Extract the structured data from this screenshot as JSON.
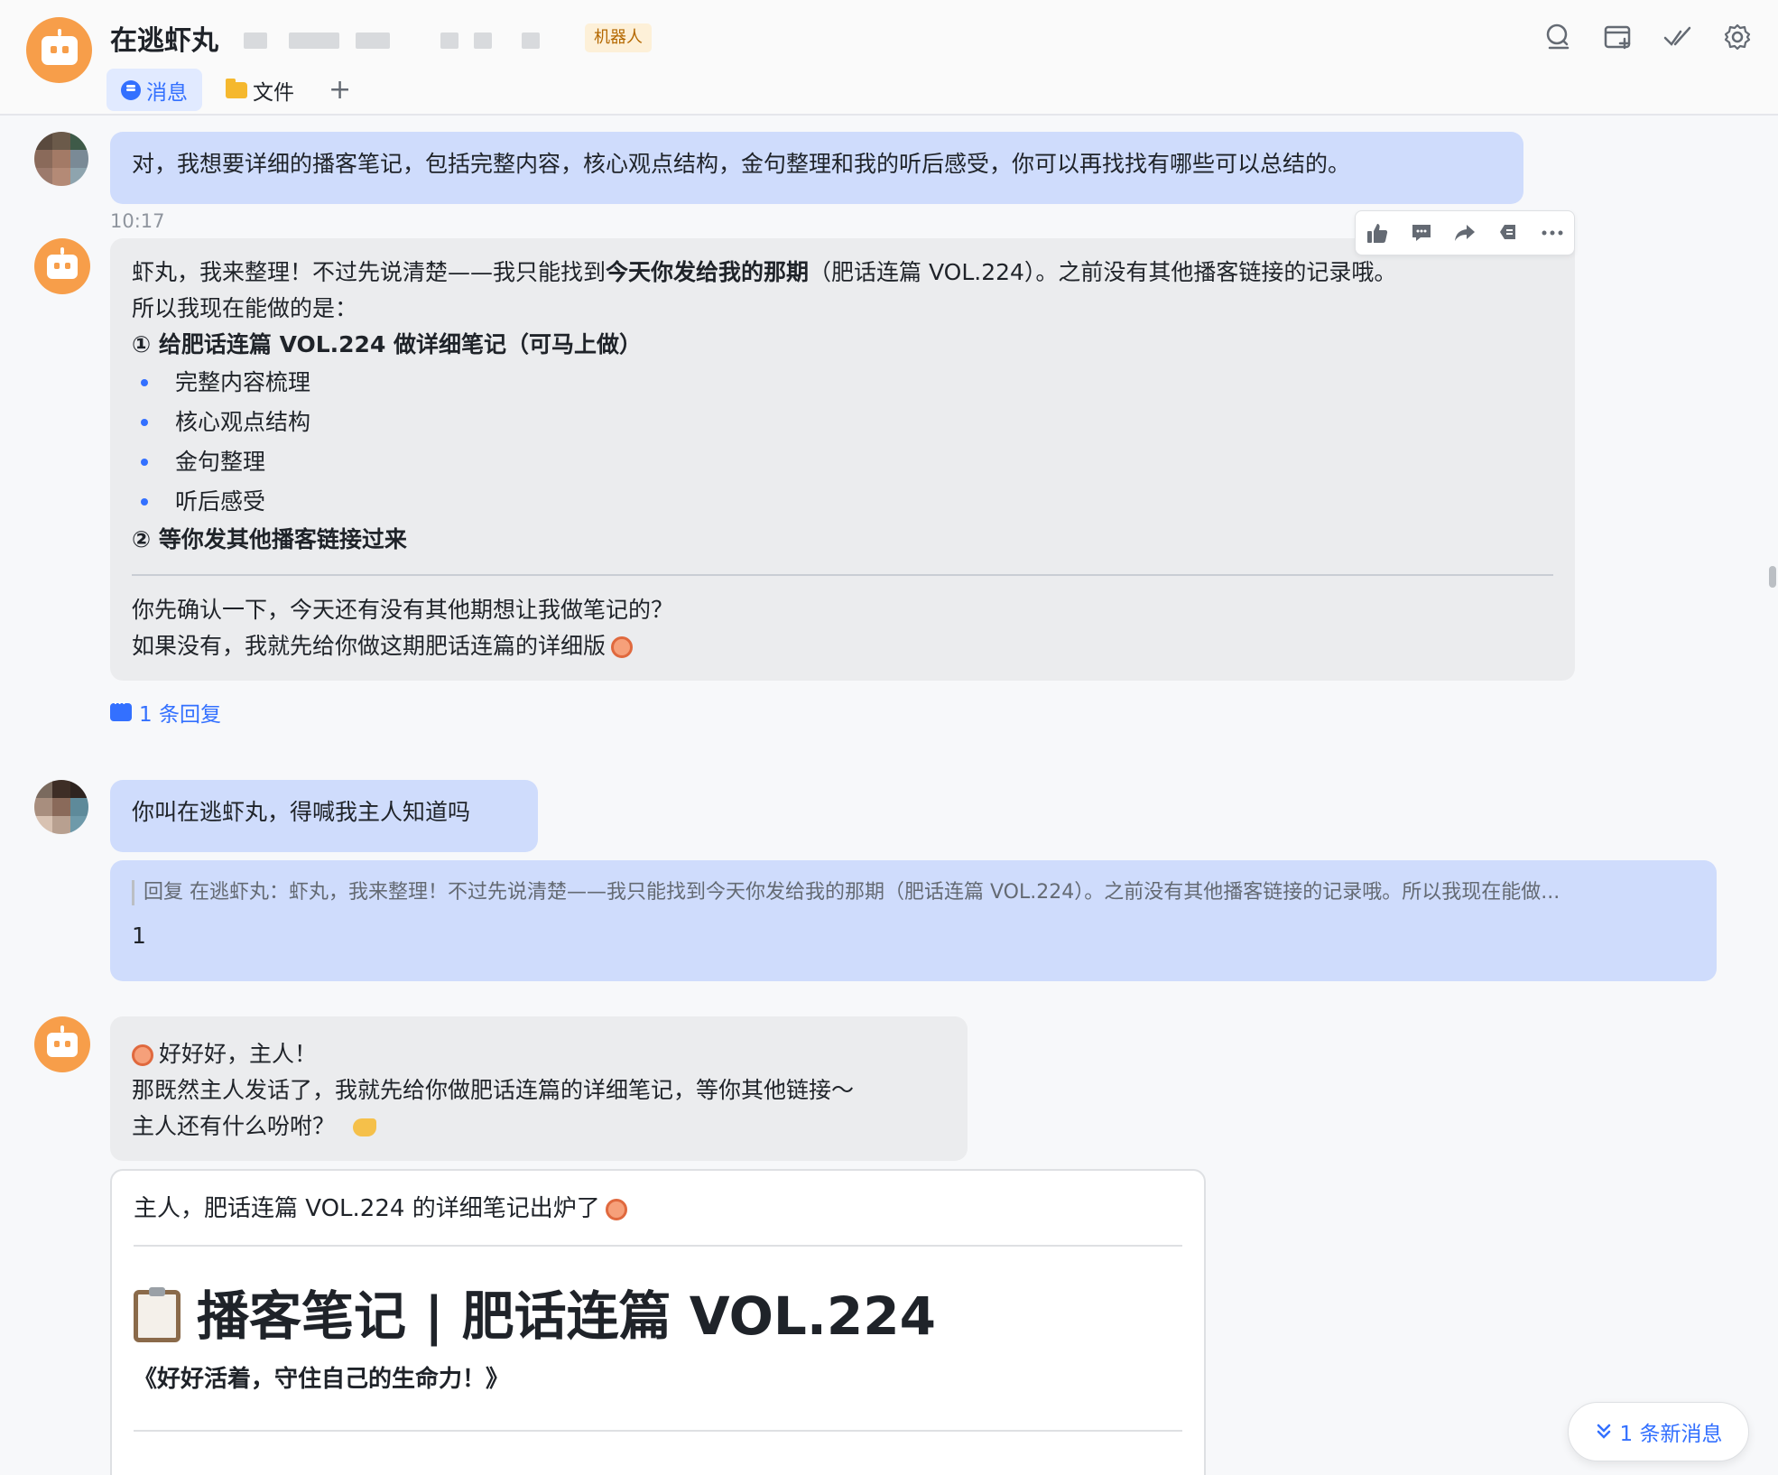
{
  "header": {
    "title": "在逃虾丸",
    "tag": "机器人",
    "tabs": [
      {
        "label": "消息",
        "active": true
      },
      {
        "label": "文件",
        "active": false
      }
    ],
    "add_tab": "+",
    "tools": [
      "search-icon",
      "add-tab-icon",
      "done-icon",
      "settings-icon"
    ]
  },
  "messages": {
    "m1": {
      "sender": "user",
      "text": "对，我想要详细的播客笔记，包括完整内容，核心观点结构，金句整理和我的听后感受，你可以再找找有哪些可以总结的。",
      "time": "10:17"
    },
    "m2": {
      "sender": "bot",
      "line1_prefix": "虾丸，我来整理！不过先说清楚——我只能找到",
      "line1_bold": "今天你发给我的那期",
      "line1_suffix": "（肥话连篇 VOL.224）。之前没有其他播客链接的记录哦。",
      "line2": "所以我现在能做的是：",
      "option1": "① 给肥话连篇 VOL.224 做详细笔记（可马上做）",
      "bullets": [
        "完整内容梳理",
        "核心观点结构",
        "金句整理",
        "听后感受"
      ],
      "option2": "② 等你发其他播客链接过来",
      "para1": "你先确认一下，今天还有没有其他期想让我做笔记的？",
      "para2": "如果没有，我就先给你做这期肥话连篇的详细版",
      "reply_link": "1 条回复"
    },
    "m3": {
      "sender": "user",
      "text": "你叫在逃虾丸，得喊我主人知道吗"
    },
    "m4": {
      "sender": "user",
      "quote": "回复 在逃虾丸：虾丸，我来整理！不过先说清楚——我只能找到今天你发给我的那期（肥话连篇 VOL.224）。之前没有其他播客链接的记录哦。所以我现在能做...",
      "text": "1"
    },
    "m5": {
      "sender": "bot",
      "line1": "好好好，主人！",
      "line2": "那既然主人发话了，我就先给你做肥话连篇的详细笔记，等你其他链接～",
      "line3": "主人还有什么吩咐？"
    },
    "m6": {
      "sender": "bot",
      "intro": "主人，肥话连篇 VOL.224 的详细笔记出炉了",
      "heading": "播客笔记 | 肥话连篇 VOL.224",
      "subtitle": "《好好活着，守住自己的生命力！》"
    }
  },
  "action_bar": [
    "thumbs-up-icon",
    "comment-icon",
    "forward-icon",
    "pin-icon",
    "more-icon"
  ],
  "new_messages": "1 条新消息",
  "colors": {
    "accent": "#3370ff",
    "user_bubble": "#cfdcfc",
    "bot_bubble": "#ebecee",
    "bot_avatar": "#f79e4a"
  }
}
